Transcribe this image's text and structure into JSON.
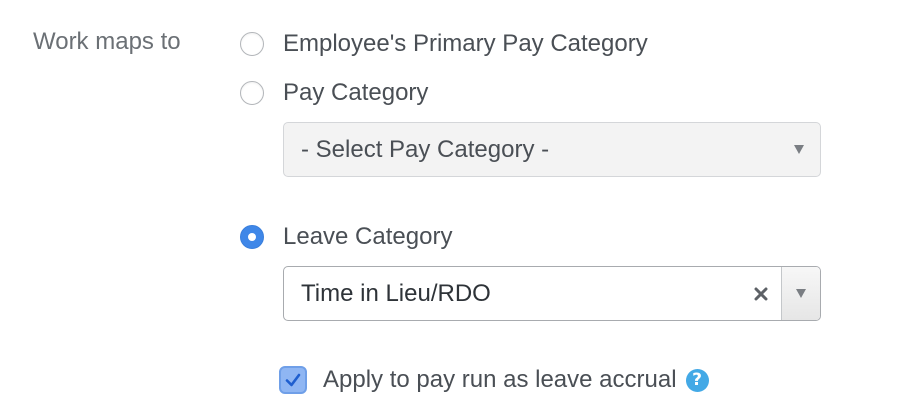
{
  "form": {
    "field_label": "Work maps to",
    "options": [
      {
        "label": "Employee's Primary Pay Category",
        "selected": false
      },
      {
        "label": "Pay Category",
        "selected": false
      },
      {
        "label": "Leave Category",
        "selected": true
      }
    ],
    "pay_category_select": {
      "value": "- Select Pay Category -",
      "disabled": true
    },
    "leave_category_select": {
      "value": "Time in Lieu/RDO",
      "clear_icon": "close-x-icon",
      "toggle_icon": "caret-down-icon"
    },
    "accrual_checkbox": {
      "label": "Apply to pay run as leave accrual",
      "checked": true,
      "help_icon": "question-mark-icon",
      "help_glyph": "?"
    }
  },
  "colors": {
    "accent": "#3f87e8",
    "checkbox_fill": "#8fb6f3",
    "help": "#43a9e6",
    "label": "#6b7075",
    "text": "#4a4f55"
  }
}
